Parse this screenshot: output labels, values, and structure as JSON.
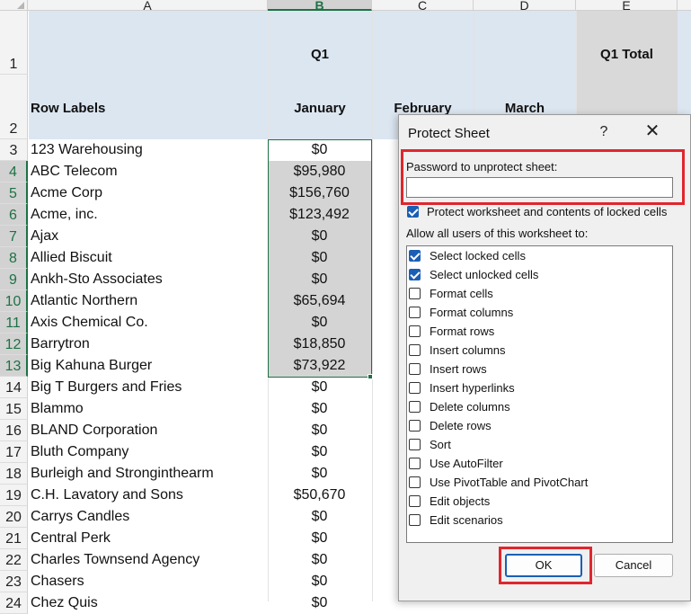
{
  "columns": [
    "A",
    "B",
    "C",
    "D",
    "E"
  ],
  "rows": [
    "1",
    "2",
    "3",
    "4",
    "5",
    "6",
    "7",
    "8",
    "9",
    "10",
    "11",
    "12",
    "13",
    "14",
    "15",
    "16",
    "17",
    "18",
    "19",
    "20",
    "21",
    "22",
    "23",
    "24"
  ],
  "header": {
    "q1": "Q1",
    "q1_total": "Q1 Total",
    "row_labels": "Row Labels",
    "january": "January",
    "february": "February",
    "march": "March"
  },
  "data_rows": [
    {
      "label": "123 Warehousing",
      "jan": "$0"
    },
    {
      "label": "ABC Telecom",
      "jan": "$95,980"
    },
    {
      "label": "Acme Corp",
      "jan": "$156,760"
    },
    {
      "label": "Acme, inc.",
      "jan": "$123,492"
    },
    {
      "label": "Ajax",
      "jan": "$0"
    },
    {
      "label": "Allied Biscuit",
      "jan": "$0"
    },
    {
      "label": "Ankh-Sto Associates",
      "jan": "$0"
    },
    {
      "label": "Atlantic Northern",
      "jan": "$65,694"
    },
    {
      "label": "Axis Chemical Co.",
      "jan": "$0"
    },
    {
      "label": "Barrytron",
      "jan": "$18,850"
    },
    {
      "label": "Big Kahuna Burger",
      "jan": "$73,922"
    },
    {
      "label": "Big T Burgers and Fries",
      "jan": "$0"
    },
    {
      "label": "Blammo",
      "jan": "$0"
    },
    {
      "label": "BLAND Corporation",
      "jan": "$0"
    },
    {
      "label": "Bluth Company",
      "jan": "$0"
    },
    {
      "label": "Burleigh and Stronginthearm",
      "jan": "$0"
    },
    {
      "label": "C.H. Lavatory and Sons",
      "jan": "$50,670"
    },
    {
      "label": "Carrys Candles",
      "jan": "$0"
    },
    {
      "label": "Central Perk",
      "jan": "$0"
    },
    {
      "label": "Charles Townsend Agency",
      "jan": "$0"
    },
    {
      "label": "Chasers",
      "jan": "$0"
    },
    {
      "label": "Chez Quis",
      "jan": "$0"
    }
  ],
  "dialog": {
    "title": "Protect Sheet",
    "help": "?",
    "close": "✕",
    "password_label": "Password to unprotect sheet:",
    "password_value": "",
    "protect_label": "Protect worksheet and contents of locked cells",
    "protect_checked": true,
    "allow_label": "Allow all users of this worksheet to:",
    "permissions": [
      {
        "label": "Select locked cells",
        "checked": true
      },
      {
        "label": "Select unlocked cells",
        "checked": true
      },
      {
        "label": "Format cells",
        "checked": false
      },
      {
        "label": "Format columns",
        "checked": false
      },
      {
        "label": "Format rows",
        "checked": false
      },
      {
        "label": "Insert columns",
        "checked": false
      },
      {
        "label": "Insert rows",
        "checked": false
      },
      {
        "label": "Insert hyperlinks",
        "checked": false
      },
      {
        "label": "Delete columns",
        "checked": false
      },
      {
        "label": "Delete rows",
        "checked": false
      },
      {
        "label": "Sort",
        "checked": false
      },
      {
        "label": "Use AutoFilter",
        "checked": false
      },
      {
        "label": "Use PivotTable and PivotChart",
        "checked": false
      },
      {
        "label": "Edit objects",
        "checked": false
      },
      {
        "label": "Edit scenarios",
        "checked": false
      }
    ],
    "ok_label": "OK",
    "cancel_label": "Cancel"
  },
  "colors": {
    "header_band": "#dce6f1",
    "selection": "#1e7145",
    "highlight_box": "#e0262d",
    "checkbox_on": "#1a5fb4"
  }
}
